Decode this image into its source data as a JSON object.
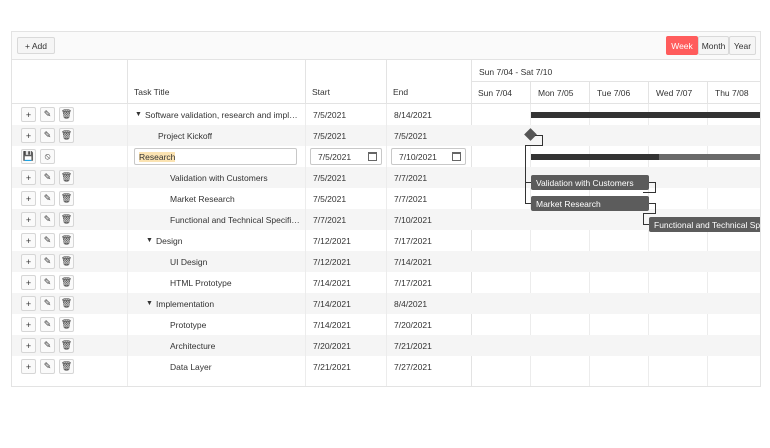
{
  "toolbar": {
    "add_label": "+ Add",
    "views": [
      "Week",
      "Month",
      "Year"
    ],
    "active_view": "Week"
  },
  "columns": {
    "title": "Task Title",
    "start": "Start",
    "end": "End"
  },
  "edit_row": {
    "title_value": "Research",
    "start_value": "7/5/2021",
    "end_value": "7/10/2021"
  },
  "tasks": [
    {
      "title": "Software validation, research and impl…",
      "start": "7/5/2021",
      "end": "8/14/2021",
      "level": 0,
      "expanded": true
    },
    {
      "title": "Project Kickoff",
      "start": "7/5/2021",
      "end": "7/5/2021",
      "level": 1
    },
    {
      "title": "Validation with Customers",
      "start": "7/5/2021",
      "end": "7/7/2021",
      "level": 2
    },
    {
      "title": "Market Research",
      "start": "7/5/2021",
      "end": "7/7/2021",
      "level": 2
    },
    {
      "title": "Functional and Technical Specifi…",
      "start": "7/7/2021",
      "end": "7/10/2021",
      "level": 2
    },
    {
      "title": "Design",
      "start": "7/12/2021",
      "end": "7/17/2021",
      "level": 1,
      "expanded": true
    },
    {
      "title": "UI Design",
      "start": "7/12/2021",
      "end": "7/14/2021",
      "level": 2
    },
    {
      "title": "HTML Prototype",
      "start": "7/14/2021",
      "end": "7/17/2021",
      "level": 2
    },
    {
      "title": "Implementation",
      "start": "7/14/2021",
      "end": "8/4/2021",
      "level": 1,
      "expanded": true
    },
    {
      "title": "Prototype",
      "start": "7/14/2021",
      "end": "7/20/2021",
      "level": 2
    },
    {
      "title": "Architecture",
      "start": "7/20/2021",
      "end": "7/21/2021",
      "level": 2
    },
    {
      "title": "Data Layer",
      "start": "7/21/2021",
      "end": "7/27/2021",
      "level": 2
    }
  ],
  "timeline": {
    "week_label": "Sun 7/04 - Sat 7/10",
    "days": [
      "Sun 7/04",
      "Mon 7/05",
      "Tue 7/06",
      "Wed 7/07",
      "Thu 7/08"
    ],
    "bars": {
      "validation": "Validation with Customers",
      "market": "Market Research",
      "functional": "Functional and Technical Spe"
    }
  },
  "icons": {
    "add": "plus-icon",
    "edit": "pencil-icon",
    "delete": "trash-icon",
    "save": "save-icon",
    "cancel": "cancel-icon",
    "calendar": "calendar-icon"
  },
  "colors": {
    "accent": "#ff5c5c",
    "bar": "#5c5c5c",
    "summary": "#333333"
  }
}
